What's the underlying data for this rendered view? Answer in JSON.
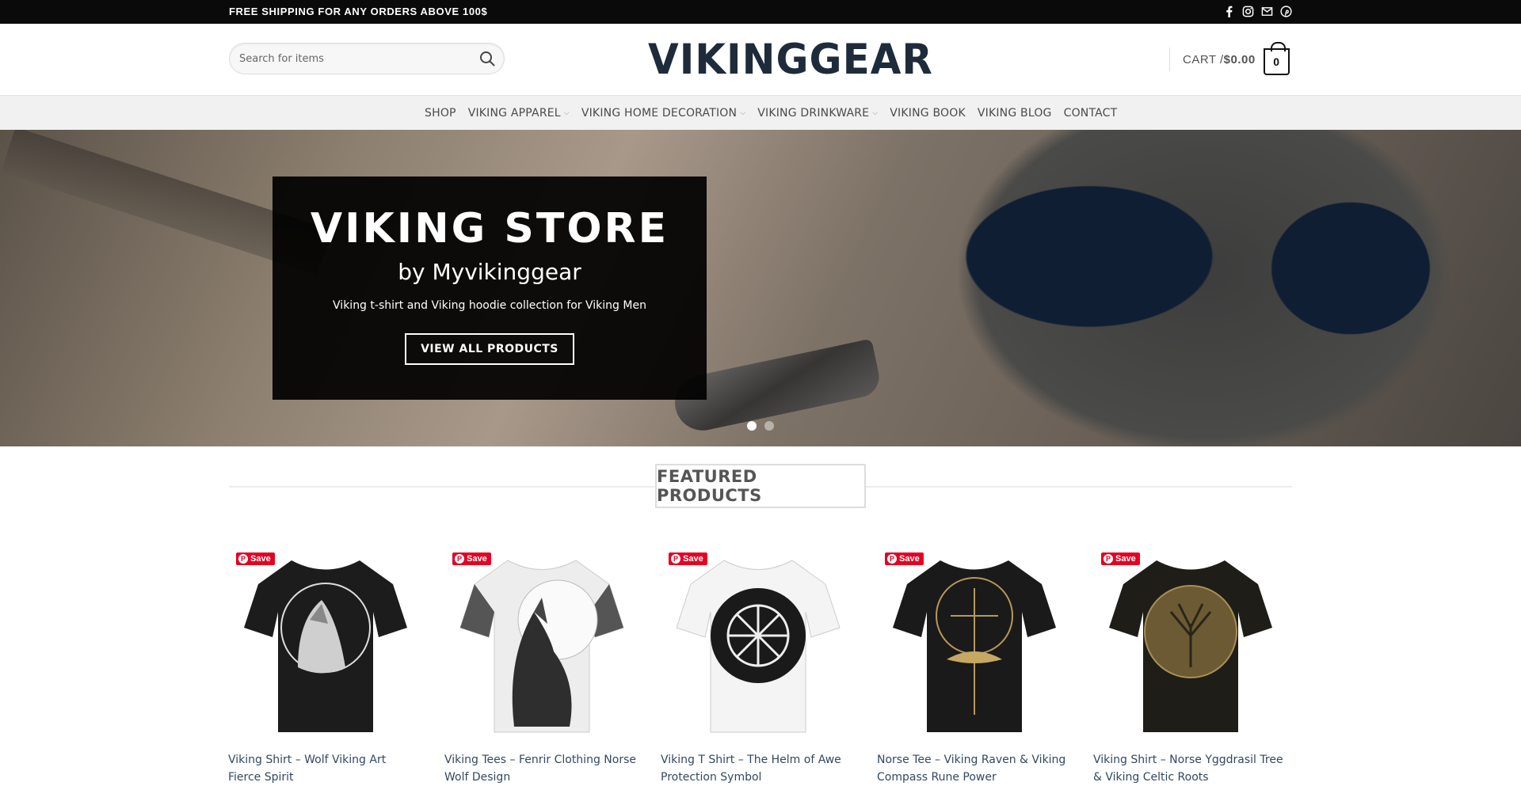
{
  "topbar": {
    "message": "FREE SHIPPING FOR ANY ORDERS ABOVE 100$",
    "socials": [
      "facebook-icon",
      "instagram-icon",
      "email-icon",
      "pinterest-icon"
    ]
  },
  "header": {
    "search_placeholder": "Search for items",
    "logo_text": "VIKINGGEAR",
    "cart_label": "CART / ",
    "cart_amount": "$0.00",
    "cart_count": "0"
  },
  "nav": {
    "items": [
      {
        "label": "SHOP"
      },
      {
        "label": "VIKING APPAREL"
      },
      {
        "label": "VIKING HOME DECORATION"
      },
      {
        "label": "VIKING DRINKWARE"
      },
      {
        "label": "VIKING BOOK"
      },
      {
        "label": "VIKING BLOG"
      },
      {
        "label": "CONTACT"
      }
    ]
  },
  "hero": {
    "title": "VIKING STORE",
    "subtitle": "by Myvikinggear",
    "description": "Viking t-shirt and Viking hoodie collection for Viking Men",
    "button": "VIEW ALL PRODUCTS"
  },
  "featured": {
    "heading": "FEATURED PRODUCTS",
    "save_label": "Save",
    "products": [
      {
        "title_line1": "Viking Shirt – Wolf Viking Art",
        "title_line2": "Fierce Spirit",
        "shirt": "black"
      },
      {
        "title_line1": "Viking Tees – Fenrir Clothing Norse",
        "title_line2": "Wolf Design",
        "shirt": "white"
      },
      {
        "title_line1": "Viking T Shirt – The Helm of Awe",
        "title_line2": "Protection Symbol",
        "shirt": "white"
      },
      {
        "title_line1": "Norse Tee – Viking Raven & Viking",
        "title_line2": "Compass Rune Power",
        "shirt": "black"
      },
      {
        "title_line1": "Viking Shirt – Norse Yggdrasil Tree",
        "title_line2": "& Viking Celtic Roots",
        "shirt": "black"
      }
    ]
  },
  "colors": {
    "topbar_bg": "#0a0a0a",
    "link": "#334862",
    "pinterest_red": "#e60023",
    "logo": "#1e2b3a"
  }
}
